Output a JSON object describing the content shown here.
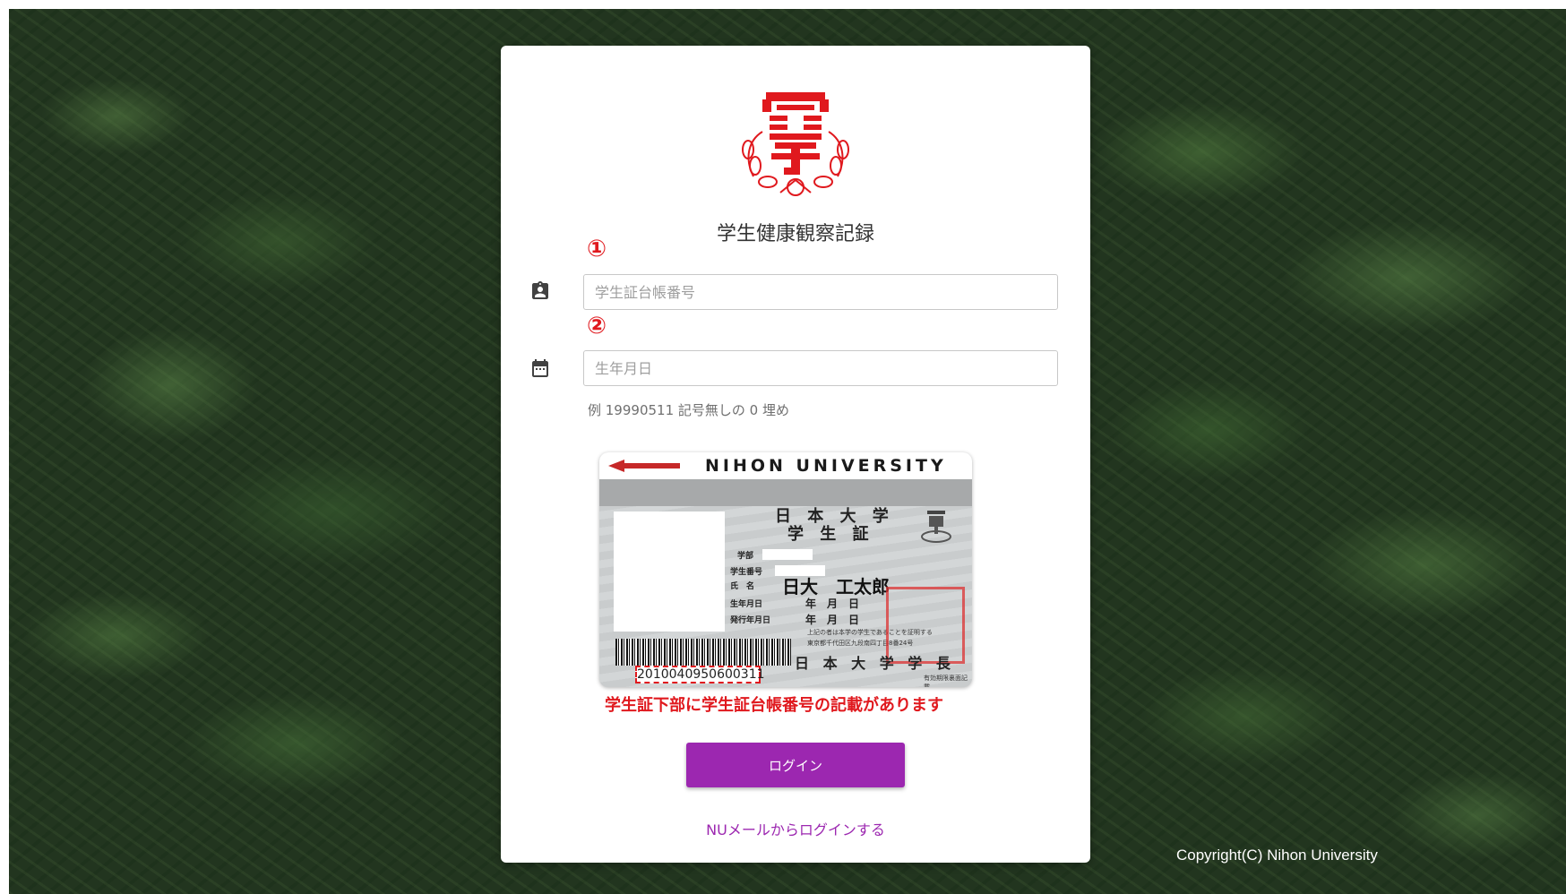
{
  "colors": {
    "accent": "#9c27b0",
    "logo_red": "#e0191e",
    "annotation_red": "#e0191e",
    "card_background": "#ffffff",
    "background_foliage": "#22351f"
  },
  "header": {
    "logo_icon": "nihon-university-crest-icon",
    "title": "学生健康観察記録"
  },
  "form": {
    "student_id": {
      "marker": "①",
      "icon": "id-badge-icon",
      "placeholder": "学生証台帳番号",
      "value": ""
    },
    "birthdate": {
      "marker": "②",
      "icon": "calendar-icon",
      "placeholder": "生年月日",
      "value": "",
      "hint": "例 19990511 記号無しの 0 埋め"
    }
  },
  "student_card_example": {
    "university_en": "NIHON UNIVERSITY",
    "university_ja": "日 本 大 学",
    "card_type": "学 生 証",
    "faculty_label": "学部",
    "student_number_label": "学生番号",
    "name_label": "氏　名",
    "name_value": "日大　工太郎",
    "birthdate_label": "生年月日",
    "issue_date_label": "発行年月日",
    "date_format": "年　月　日",
    "certification_text": "上記の者は本学の学生であることを証明する",
    "address_text": "東京都千代田区九段南四丁目8番24号",
    "president": "日 本 大 学 学 長",
    "ledger_number": "2010040950600311",
    "back_note": "有効期限裏面記載",
    "caption": "学生証下部に学生証台帳番号の記載があります"
  },
  "actions": {
    "login_label": "ログイン",
    "nu_mail_login_label": "NUメールからログインする"
  },
  "footer": {
    "copyright": "Copyright(C) Nihon University"
  }
}
